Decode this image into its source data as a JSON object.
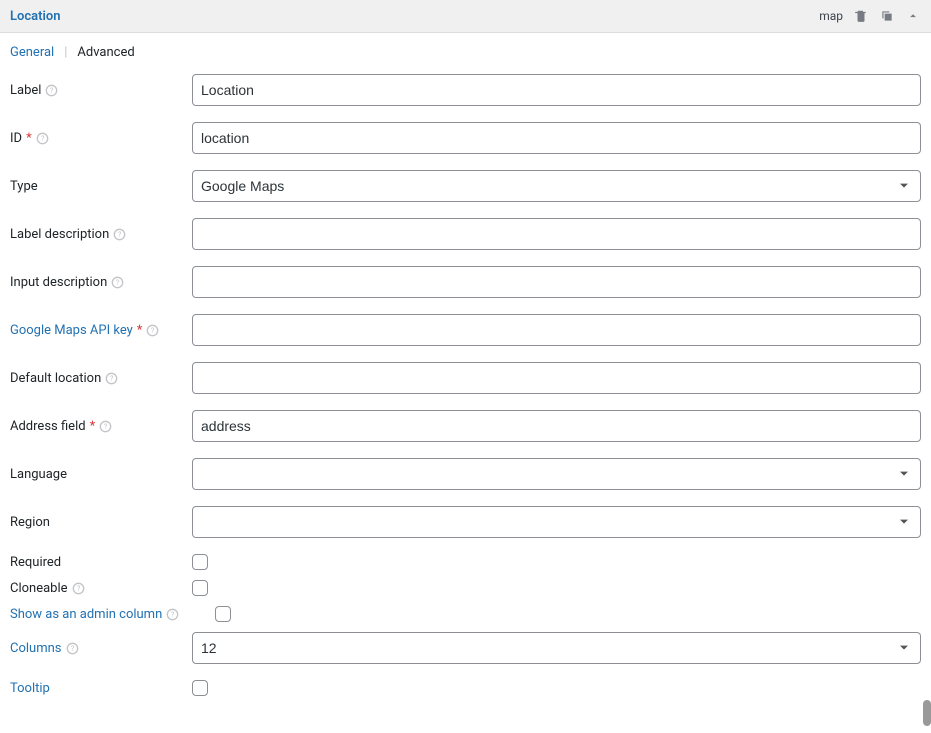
{
  "header": {
    "title": "Location",
    "type_code": "map"
  },
  "tabs": {
    "general": "General",
    "advanced": "Advanced"
  },
  "fields": {
    "label": {
      "name": "Label",
      "value": "Location"
    },
    "id": {
      "name": "ID",
      "value": "location"
    },
    "type": {
      "name": "Type",
      "value": "Google Maps"
    },
    "label_desc": {
      "name": "Label description",
      "value": ""
    },
    "input_desc": {
      "name": "Input description",
      "value": ""
    },
    "api_key": {
      "name": "Google Maps API key",
      "value": ""
    },
    "default_loc": {
      "name": "Default location",
      "value": ""
    },
    "address_field": {
      "name": "Address field",
      "value": "address"
    },
    "language": {
      "name": "Language",
      "value": ""
    },
    "region": {
      "name": "Region",
      "value": ""
    },
    "required": {
      "name": "Required"
    },
    "cloneable": {
      "name": "Cloneable"
    },
    "admin_col": {
      "name": "Show as an admin column"
    },
    "columns": {
      "name": "Columns",
      "value": "12"
    },
    "tooltip": {
      "name": "Tooltip"
    }
  }
}
